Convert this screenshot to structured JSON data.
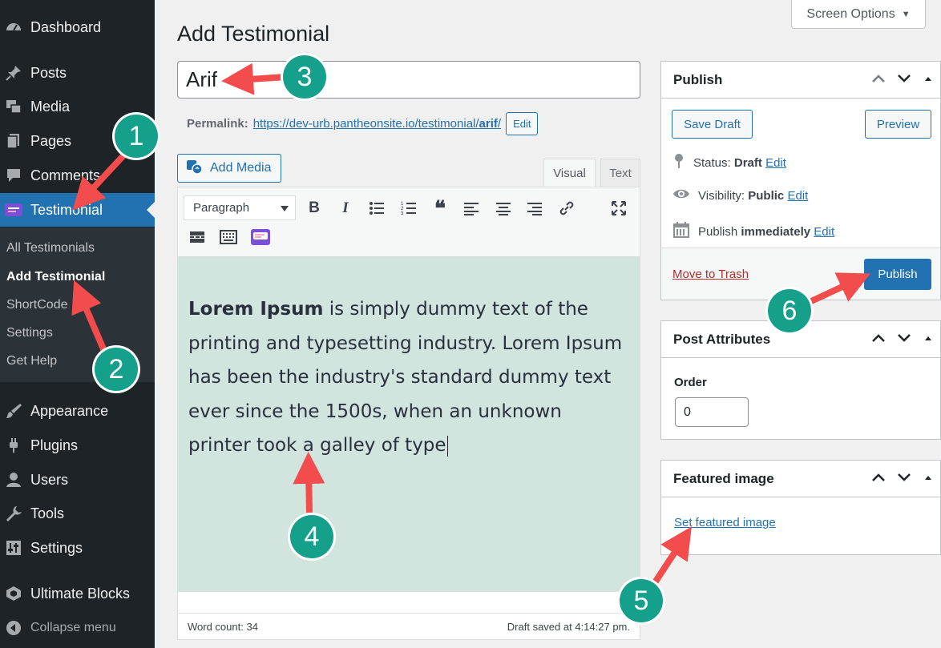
{
  "sidebar": {
    "items": [
      {
        "label": "Dashboard",
        "icon": "dashboard-icon"
      },
      {
        "label": "Posts",
        "icon": "pin-icon"
      },
      {
        "label": "Media",
        "icon": "media-icon"
      },
      {
        "label": "Pages",
        "icon": "pages-icon"
      },
      {
        "label": "Comments",
        "icon": "comment-icon"
      },
      {
        "label": "Testimonial",
        "icon": "testimonial-icon"
      },
      {
        "label": "Appearance",
        "icon": "brush-icon"
      },
      {
        "label": "Plugins",
        "icon": "plug-icon"
      },
      {
        "label": "Users",
        "icon": "user-icon"
      },
      {
        "label": "Tools",
        "icon": "wrench-icon"
      },
      {
        "label": "Settings",
        "icon": "settings-icon"
      },
      {
        "label": "Ultimate Blocks",
        "icon": "blocks-icon"
      }
    ],
    "submenu": [
      "All Testimonials",
      "Add Testimonial",
      "ShortCode",
      "Settings",
      "Get Help"
    ],
    "collapse": "Collapse menu"
  },
  "header": {
    "title": "Add Testimonial",
    "screen_options": "Screen Options"
  },
  "post": {
    "title": "Arif",
    "permalink_label": "Permalink:",
    "permalink_base": "https://dev-urb.pantheonsite.io/testimonial/",
    "permalink_slug": "arif",
    "permalink_end": "/",
    "permalink_edit": "Edit"
  },
  "editor": {
    "add_media": "Add Media",
    "tab_visual": "Visual",
    "tab_text": "Text",
    "format": "Paragraph",
    "content_bold": "Lorem Ipsum",
    "content_rest": " is simply dummy text of the printing and typesetting industry. Lorem Ipsum has been the industry's standard dummy text ever since the 1500s, when an unknown printer took a galley of type",
    "word_count": "Word count: 34",
    "draft_saved": "Draft saved at 4:14:27 pm."
  },
  "publish": {
    "title": "Publish",
    "save_draft": "Save Draft",
    "preview": "Preview",
    "status_label": "Status:",
    "status_value": "Draft",
    "visibility_label": "Visibility:",
    "visibility_value": "Public",
    "publish_label": "Publish",
    "publish_value": "immediately",
    "edit": "Edit",
    "trash": "Move to Trash",
    "publish_button": "Publish"
  },
  "attributes": {
    "title": "Post Attributes",
    "order_label": "Order",
    "order_value": "0"
  },
  "featured": {
    "title": "Featured image",
    "set_link": "Set featured image"
  },
  "annotations": [
    "1",
    "2",
    "3",
    "4",
    "5",
    "6"
  ],
  "colors": {
    "sidebar_bg": "#1d2327",
    "accent": "#2271b1",
    "badge": "#14a08a",
    "arrow": "#f24c4c",
    "editor_bg": "#d1e4dd"
  }
}
